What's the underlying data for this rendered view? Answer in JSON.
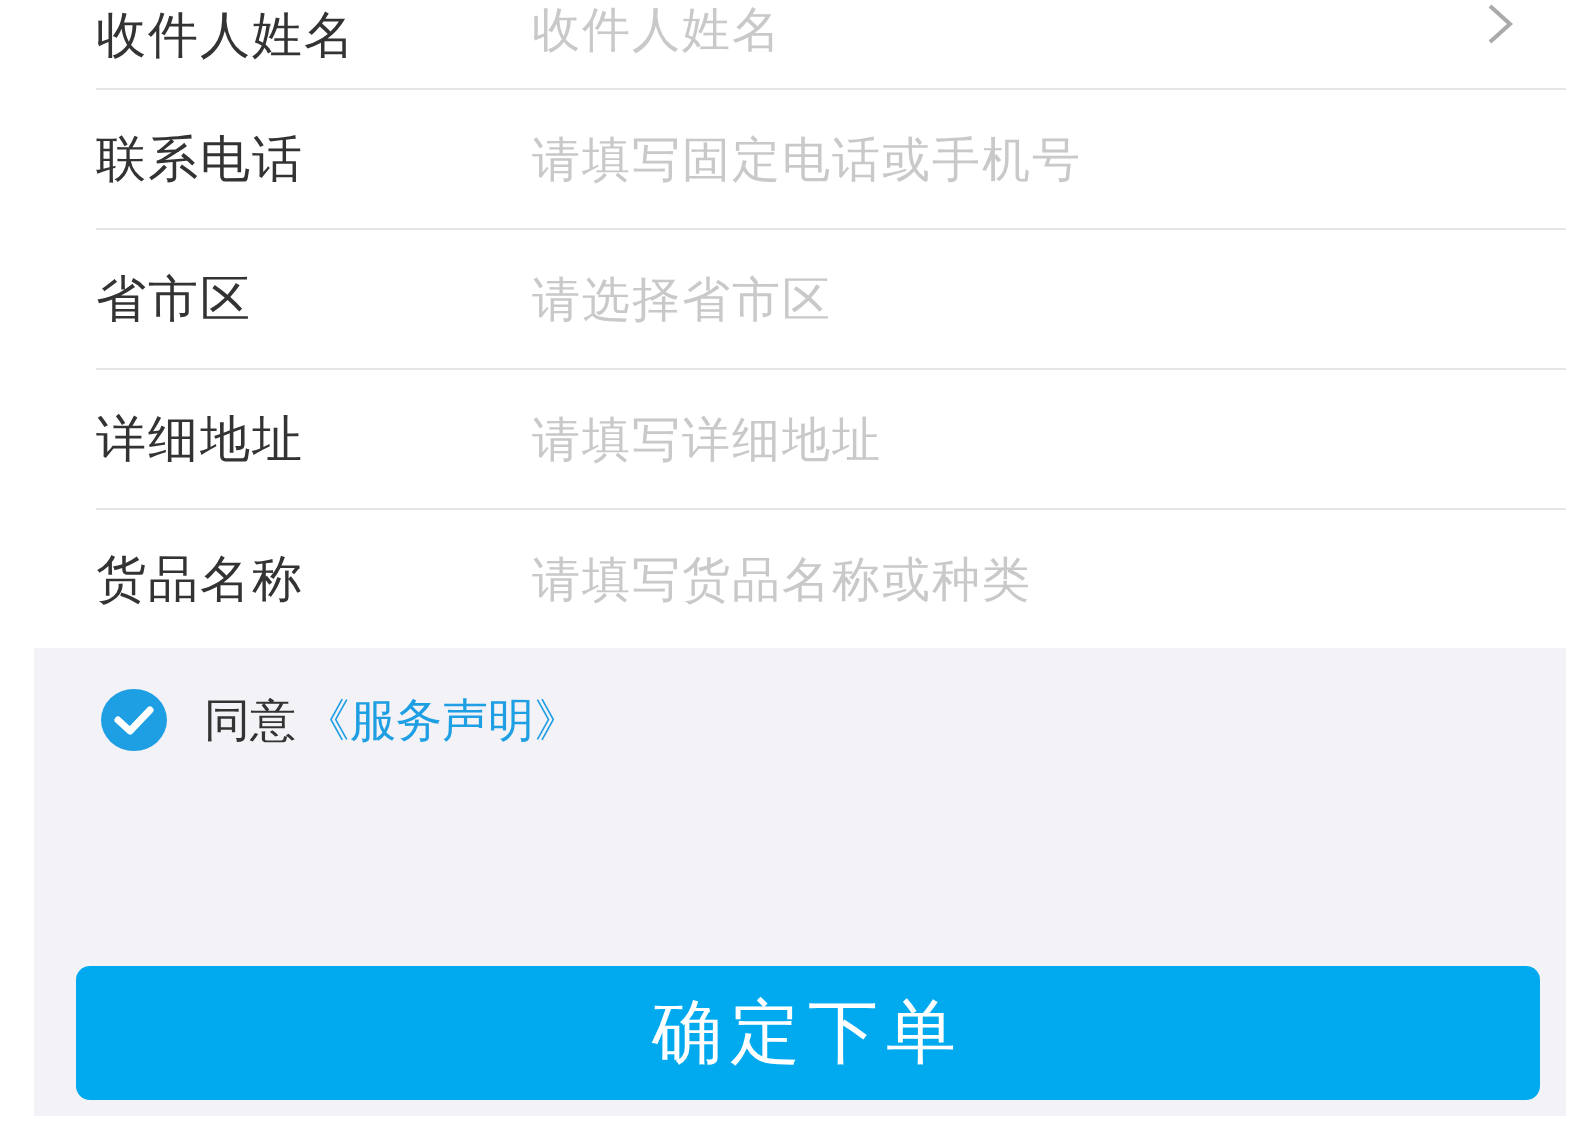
{
  "fields": [
    {
      "kind": "picker",
      "label": "收件人姓名",
      "placeholder": "收件人姓名"
    },
    {
      "kind": "text",
      "label": "联系电话",
      "placeholder": "请填写固定电话或手机号"
    },
    {
      "kind": "text",
      "label": "省市区",
      "placeholder": "请选择省市区"
    },
    {
      "kind": "text",
      "label": "详细地址",
      "placeholder": "请填写详细地址"
    },
    {
      "kind": "text",
      "label": "货品名称",
      "placeholder": "请填写货品名称或种类"
    }
  ],
  "agreement": {
    "checked": true,
    "text": "同意",
    "link": "《服务声明》"
  },
  "submit": "确定下单"
}
